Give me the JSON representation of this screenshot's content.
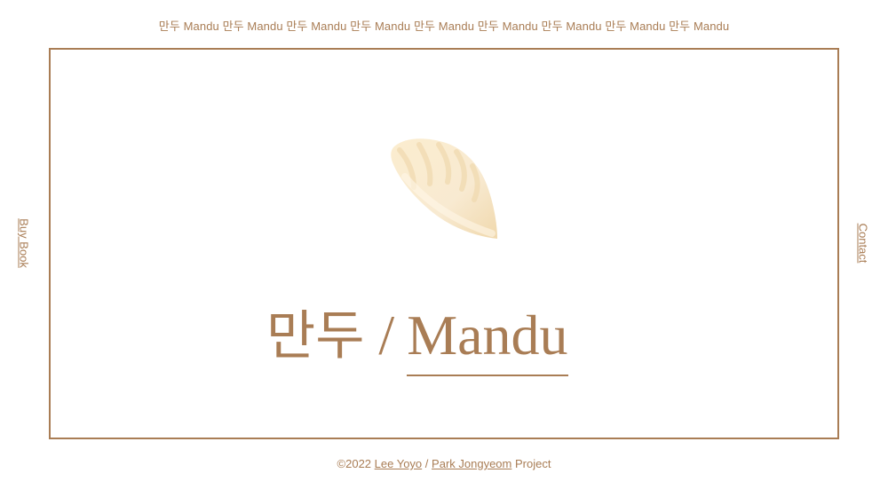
{
  "ticker": {
    "text": "만두 Mandu 만두 Mandu 만두 Mandu 만두 Mandu 만두 Mandu 만두 Mandu 만두 Mandu 만두 Mandu 만두 Mandu"
  },
  "side_links": {
    "buy_book": "Buy Book",
    "contact": "Contact"
  },
  "hero": {
    "title_ko": "만두",
    "separator": "/",
    "title_en": "Mandu"
  },
  "footer": {
    "copyright": "©2022",
    "author1": "Lee Yoyo",
    "divider": "/",
    "author2": "Park Jongyeom",
    "suffix": "Project"
  },
  "colors": {
    "accent": "#a97d55",
    "background": "#ffffff",
    "dumpling_light": "#fbf1dd",
    "dumpling_shade": "#f1dcb4"
  },
  "icons": {
    "hero_image": "dumpling-illustration"
  }
}
